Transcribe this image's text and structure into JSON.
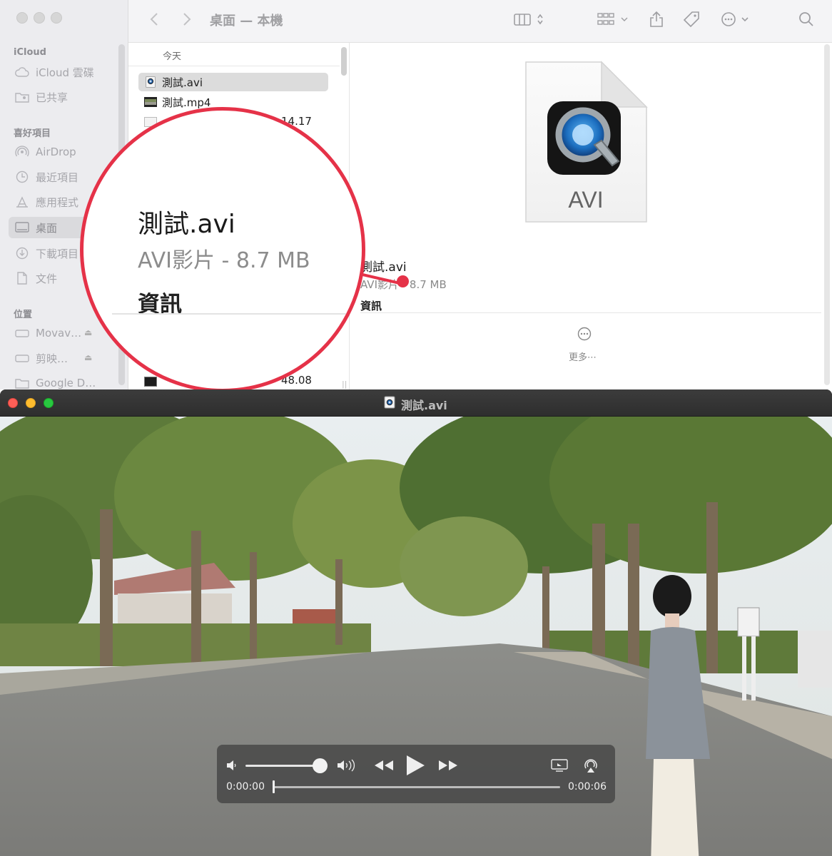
{
  "finder": {
    "title": "桌面 — 本機",
    "sidebar": {
      "sections": {
        "icloud": "iCloud",
        "favorites": "喜好項目",
        "locations": "位置"
      },
      "items": [
        {
          "label": "iCloud 雲碟",
          "icon": "cloud-icon"
        },
        {
          "label": "已共享",
          "icon": "shared-folder-icon"
        },
        {
          "label": "AirDrop",
          "icon": "airdrop-icon"
        },
        {
          "label": "最近項目",
          "icon": "clock-icon"
        },
        {
          "label": "應用程式",
          "icon": "apps-icon"
        },
        {
          "label": "桌面",
          "icon": "desktop-icon"
        },
        {
          "label": "下載項目",
          "icon": "download-icon"
        },
        {
          "label": "文件",
          "icon": "document-icon"
        },
        {
          "label": "Movav…",
          "icon": "drive-icon"
        },
        {
          "label": "剪映…",
          "icon": "drive-icon"
        },
        {
          "label": "Google D…",
          "icon": "folder-icon"
        }
      ]
    },
    "column": {
      "header": "今天",
      "rows": [
        {
          "name": "測試.avi",
          "selected": true
        },
        {
          "name": "測試.mp4",
          "selected": false
        }
      ],
      "partial_right_1": "14.17",
      "partial_right_2": "48.08"
    },
    "preview": {
      "badge": "AVI",
      "file_name": "測試.avi",
      "file_meta": "AVI影片 - 8.7 MB",
      "info_heading": "資訊",
      "more_label": "更多⋯"
    },
    "magnifier": {
      "file_name": "測試.avi",
      "file_meta": "AVI影片 - 8.7 MB",
      "info_heading": "資訊"
    },
    "colors": {
      "highlight": "#e53248"
    }
  },
  "player": {
    "title": "測試.avi",
    "time_elapsed": "0:00:00",
    "time_total": "0:00:06",
    "volume_level": 0.95,
    "playback_position": 0.0
  }
}
